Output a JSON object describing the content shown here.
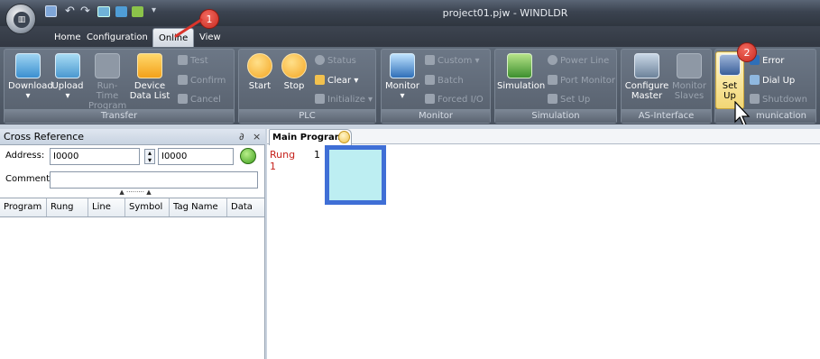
{
  "window": {
    "title": "project01.pjw - WINDLDR"
  },
  "tabs": {
    "home": "Home",
    "configuration": "Configuration",
    "online": "Online",
    "view": "View"
  },
  "transfer": {
    "label": "Transfer",
    "download": "Download",
    "upload": "Upload",
    "runtime_l1": "Run-Time",
    "runtime_l2": "Program",
    "device_l1": "Device",
    "device_l2": "Data List",
    "test": "Test",
    "confirm": "Confirm",
    "cancel": "Cancel"
  },
  "plc": {
    "label": "PLC",
    "start": "Start",
    "stop": "Stop",
    "status": "Status",
    "clear": "Clear",
    "initialize": "Initialize"
  },
  "monitor": {
    "label": "Monitor",
    "monitor": "Monitor",
    "custom": "Custom",
    "batch": "Batch",
    "forced": "Forced I/O"
  },
  "simulation": {
    "label": "Simulation",
    "simulation": "Simulation",
    "power_line": "Power Line",
    "port_monitor": "Port Monitor",
    "set_up": "Set Up"
  },
  "as_interface": {
    "label": "AS-Interface",
    "configure_l1": "Configure",
    "configure_l2": "Master",
    "monitor_l1": "Monitor",
    "monitor_l2": "Slaves"
  },
  "communication": {
    "label": "munication",
    "set_up": "Set Up",
    "error": "Error",
    "dial_up": "Dial Up",
    "shutdown": "Shutdown"
  },
  "callouts": {
    "one": "1",
    "two": "2"
  },
  "cross_reference": {
    "title": "Cross Reference",
    "pin": "∂",
    "close": "×",
    "address_label": "Address:",
    "address_value": "I0000",
    "address_value2": "I0000",
    "comment_label": "Comment",
    "columns": [
      "Program",
      "Rung",
      "Line",
      "Symbol",
      "Tag Name",
      "Data"
    ]
  },
  "editor": {
    "tab": "Main Program",
    "rung_label": "Rung",
    "rung_number": "1",
    "rung_index": "1"
  },
  "colors": {
    "accent_callout": "#d9342b",
    "highlight": "#f6e7a2",
    "cell_fill": "#bdeef2",
    "cell_border": "#3f6fd6"
  }
}
